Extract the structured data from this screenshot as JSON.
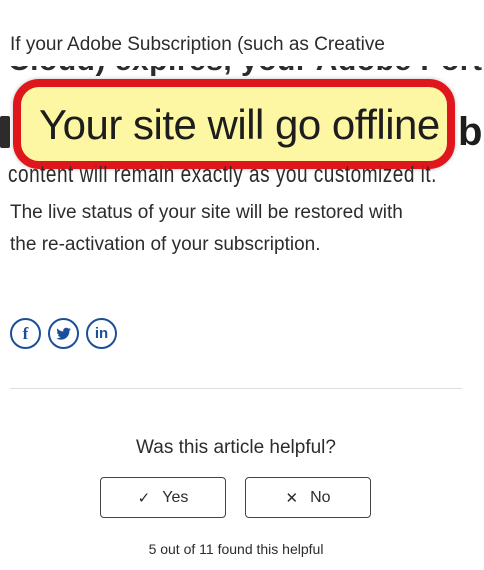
{
  "article": {
    "line1": "If your Adobe Subscription (such as Creative",
    "line2_partial": "Cloud) expires, your Adobe Portfolio s",
    "callout_text": "Your site will go offline",
    "line4_partial": "content will remain exactly as you customized it.",
    "line5": "The live status of your site will be restored with",
    "line6": "the re-activation of your subscription."
  },
  "share": {
    "facebook": "f",
    "twitter_icon": "twitter-bird-icon",
    "linkedin": "in"
  },
  "feedback": {
    "question": "Was this article helpful?",
    "yes_label": "Yes",
    "no_label": "No",
    "yes_icon": "✓",
    "no_icon": "✕",
    "summary": "5 out of 11 found this helpful"
  },
  "colors": {
    "callout_border": "#e0161d",
    "callout_fill": "#fdf7a4",
    "share_blue": "#1b4f9b"
  }
}
